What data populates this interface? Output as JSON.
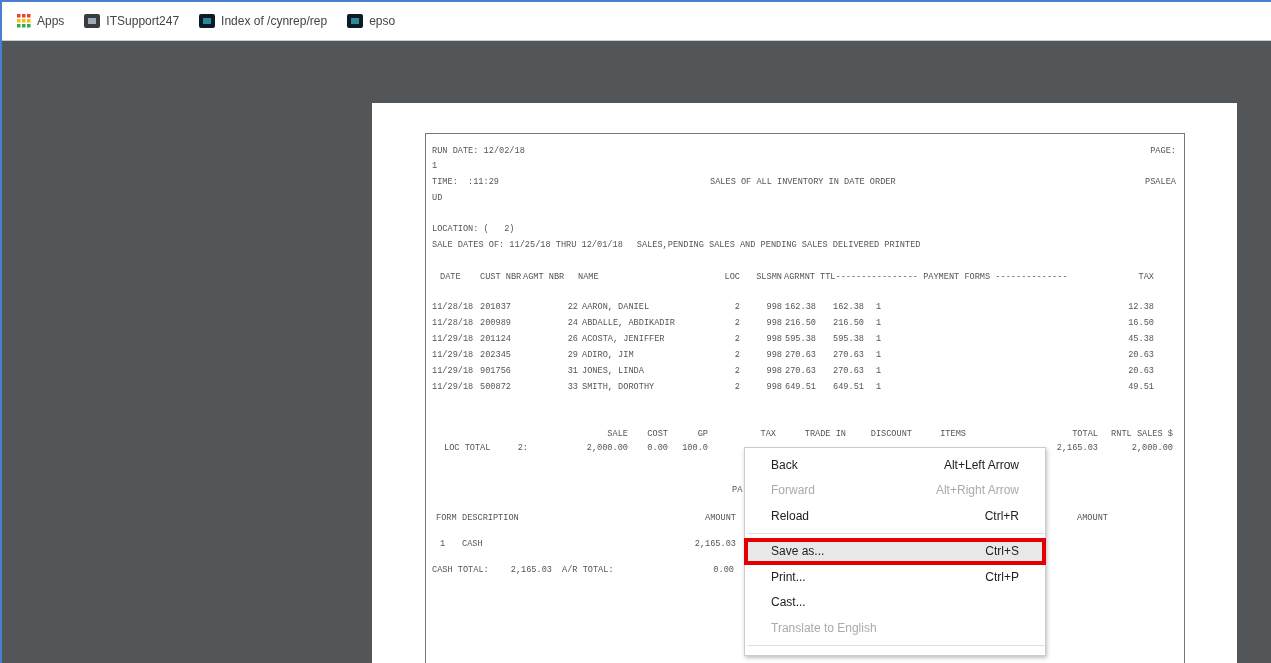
{
  "bookmarks": [
    {
      "kind": "apps",
      "label": "Apps"
    },
    {
      "kind": "site",
      "label": "ITSupport247"
    },
    {
      "kind": "site",
      "label": "Index of /cynrep/rep"
    },
    {
      "kind": "site",
      "label": "epso"
    }
  ],
  "report": {
    "run_date": "RUN DATE: 12/02/18",
    "page_label": "PAGE:",
    "page_number": "1",
    "time_label": "TIME:",
    "time": ":11:29",
    "title": "SALES OF ALL INVENTORY IN DATE ORDER",
    "program": "PSALEA",
    "program_cont": "UD",
    "location": "LOCATION: (   2)",
    "sale_dates": "SALE DATES OF: 11/25/18 THRU 12/01/18",
    "filter": "SALES,PENDING SALES AND PENDING SALES DELIVERED PRINTED",
    "columns": [
      "DATE",
      "CUST NBR",
      "AGMT NBR",
      "NAME",
      "LOC",
      "SLSMN",
      "AGRMNT",
      "TTL---------------- PAYMENT FORMS --------------",
      "",
      "TAX"
    ],
    "rows": [
      [
        "11/28/18",
        "201037",
        "22",
        "AARON, DANIEL",
        "2",
        "998",
        "162.38",
        "162.38",
        "1",
        "12.38"
      ],
      [
        "11/28/18",
        "200989",
        "24",
        "ABDALLE, ABDIKADIR",
        "2",
        "998",
        "216.50",
        "216.50",
        "1",
        "16.50"
      ],
      [
        "11/29/18",
        "201124",
        "26",
        "ACOSTA, JENIFFER",
        "2",
        "998",
        "595.38",
        "595.38",
        "1",
        "45.38"
      ],
      [
        "11/29/18",
        "202345",
        "29",
        "ADIRO, JIM",
        "2",
        "998",
        "270.63",
        "270.63",
        "1",
        "20.63"
      ],
      [
        "11/29/18",
        "901756",
        "31",
        "JONES, LINDA",
        "2",
        "998",
        "270.63",
        "270.63",
        "1",
        "20.63"
      ],
      [
        "11/29/18",
        "500872",
        "33",
        "SMITH, DOROTHY",
        "2",
        "998",
        "649.51",
        "649.51",
        "1",
        "49.51"
      ]
    ],
    "summary": {
      "label": "LOC TOTAL",
      "location": "2:",
      "columns": [
        {
          "heading": "SALE",
          "value": "2,000.00"
        },
        {
          "heading": "COST",
          "value": "0.00"
        },
        {
          "heading": "GP",
          "value": "100.0"
        },
        {
          "heading": "TAX"
        },
        {
          "heading": "TRADE IN"
        },
        {
          "heading": "DISCOUNT"
        },
        {
          "heading": "ITEMS"
        },
        {
          "heading": "TOTAL",
          "value": "2,165.03"
        },
        {
          "heading": "RNTL SALES $",
          "value": "2,000.00"
        }
      ]
    },
    "payments": {
      "title": "PA",
      "columns": [
        "FORM",
        "DESCRIPTION",
        "AMOUNT",
        "AMOUNT"
      ],
      "rows": [
        {
          "form": "1",
          "description": "CASH",
          "amount": "2,165.03"
        }
      ],
      "cash_total_label": "CASH TOTAL:",
      "cash_total": "2,165.03",
      "ar_total_label": "A/R TOTAL:",
      "ar_total": "0.00"
    }
  },
  "context_menu": [
    {
      "kind": "item",
      "label": "Back",
      "shortcut": "Alt+Left Arrow",
      "disabled": false,
      "selected": false,
      "outlined": false
    },
    {
      "kind": "item",
      "label": "Forward",
      "shortcut": "Alt+Right Arrow",
      "disabled": true,
      "selected": false,
      "outlined": false
    },
    {
      "kind": "item",
      "label": "Reload",
      "shortcut": "Ctrl+R",
      "disabled": false,
      "selected": false,
      "outlined": false
    },
    {
      "kind": "separator"
    },
    {
      "kind": "item",
      "label": "Save as...",
      "shortcut": "Ctrl+S",
      "disabled": false,
      "selected": true,
      "outlined": true
    },
    {
      "kind": "item",
      "label": "Print...",
      "shortcut": "Ctrl+P",
      "disabled": false,
      "selected": false,
      "outlined": false
    },
    {
      "kind": "item",
      "label": "Cast...",
      "disabled": false,
      "selected": false,
      "outlined": false
    },
    {
      "kind": "item",
      "label": "Translate to English",
      "disabled": true,
      "selected": false,
      "outlined": false
    },
    {
      "kind": "separator"
    }
  ]
}
